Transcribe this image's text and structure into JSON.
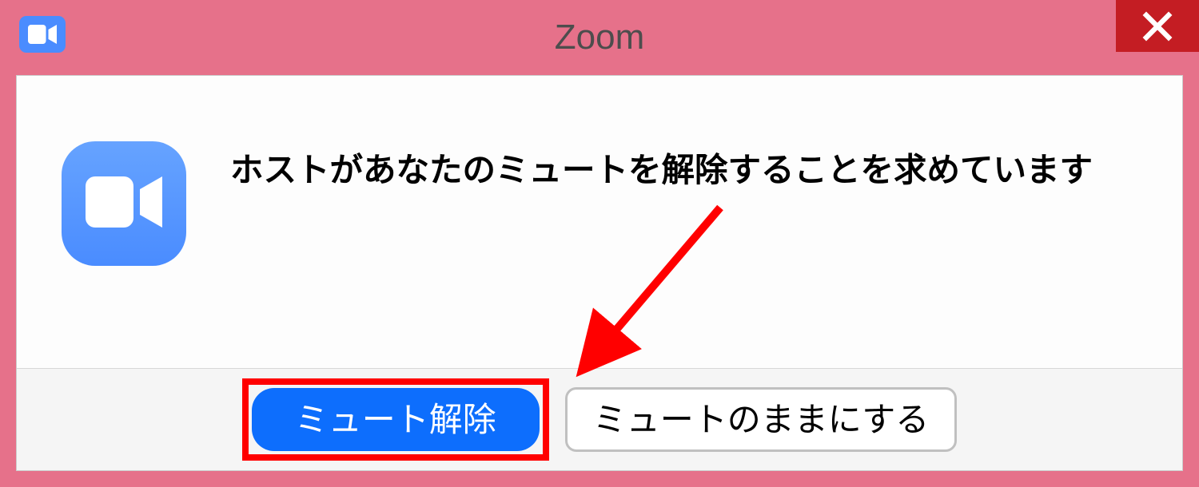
{
  "title": "Zoom",
  "dialog": {
    "message": "ホストがあなたのミュートを解除することを求めています"
  },
  "buttons": {
    "primary": "ミュート解除",
    "secondary": "ミュートのままにする"
  }
}
